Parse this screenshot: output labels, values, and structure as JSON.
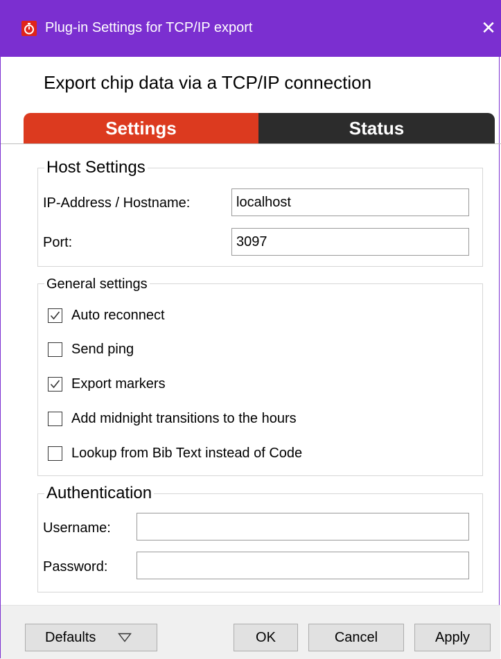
{
  "window": {
    "title": "Plug-in Settings for TCP/IP export",
    "close_symbol": "✕",
    "app_icon": "stopwatch-icon",
    "titlebar_color": "#7b2fd0"
  },
  "subtitle": "Export chip data via a TCP/IP connection",
  "tabs": [
    {
      "label": "Settings",
      "active": true,
      "color": "#dc3a1f"
    },
    {
      "label": "Status",
      "active": false,
      "color": "#2c2c2c"
    }
  ],
  "host_settings": {
    "legend": "Host Settings",
    "hostname_label": "IP-Address / Hostname:",
    "hostname_value": "localhost",
    "port_label": "Port:",
    "port_value": "3097"
  },
  "general_settings": {
    "legend": "General settings",
    "options": [
      {
        "label": "Auto reconnect",
        "checked": true
      },
      {
        "label": "Send ping",
        "checked": false
      },
      {
        "label": "Export markers",
        "checked": true
      },
      {
        "label": "Add midnight transitions to the hours",
        "checked": false
      },
      {
        "label": "Lookup from Bib Text instead of Code",
        "checked": false
      }
    ]
  },
  "authentication": {
    "legend": "Authentication",
    "username_label": "Username:",
    "username_value": "",
    "password_label": "Password:",
    "password_value": ""
  },
  "footer": {
    "defaults_label": "Defaults",
    "defaults_icon": "triangle-down-icon",
    "ok_label": "OK",
    "cancel_label": "Cancel",
    "apply_label": "Apply"
  }
}
